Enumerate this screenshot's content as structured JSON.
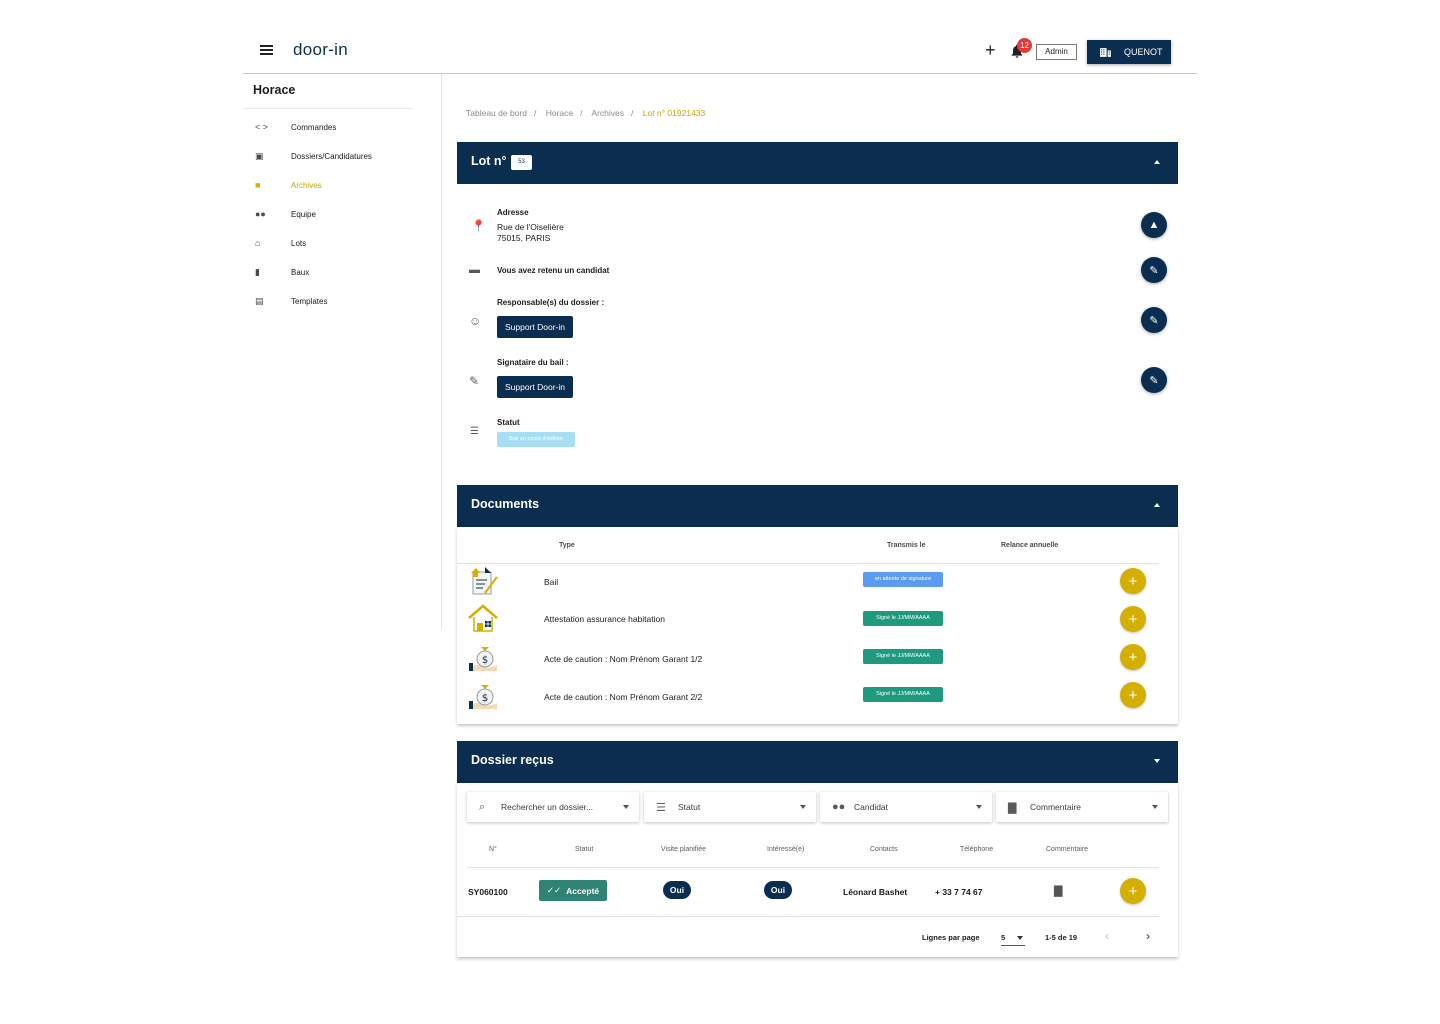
{
  "header": {
    "logo_text": "door-in",
    "notification_count": "12",
    "admin_label": "Admin",
    "company_label": "QUENOT"
  },
  "sidebar": {
    "title": "Horace",
    "items": [
      {
        "label": "Commandes",
        "icon": "code-icon"
      },
      {
        "label": "Dossiers/Candidatures",
        "icon": "id-card-icon"
      },
      {
        "label": "Archives",
        "icon": "archive-icon",
        "active": true
      },
      {
        "label": "Equipe",
        "icon": "people-icon"
      },
      {
        "label": "Lots",
        "icon": "home-icon"
      },
      {
        "label": "Baux",
        "icon": "book-icon"
      },
      {
        "label": "Templates",
        "icon": "document-icon"
      }
    ]
  },
  "breadcrumb": [
    "Tableau de bord",
    "Horace",
    "Archives",
    "Lot n° 01921433"
  ],
  "lot_panel": {
    "title": "Lot n°",
    "badge": "53",
    "address_label": "Adresse",
    "address_line1": "Rue de l'Oiselière",
    "address_line2": "75015, PARIS",
    "candidate_text": "Vous avez retenu un candidat",
    "responsible_label": "Responsable(s) du dossier :",
    "responsible_value": "Support Door-in",
    "signatory_label": "Signataire du bail :",
    "signatory_value": "Support Door-in",
    "status_label": "Statut",
    "status_value": "Bail en cours d'édition"
  },
  "documents_panel": {
    "title": "Documents",
    "headers": {
      "type": "Type",
      "sent": "Transmis le",
      "reminder": "Relance annuelle"
    },
    "rows": [
      {
        "name": "Bail",
        "tag": "en attente de signature",
        "tag_color": "#5b9bf0",
        "icon": "contract-icon"
      },
      {
        "name": "Attestation assurance habitation",
        "tag": "Signé le JJ/MM/AAAA",
        "tag_color": "#1f9a7f",
        "icon": "house-icon"
      },
      {
        "name": "Acte de caution : Nom Prénom Garant 1/2",
        "tag": "Signé le JJ/MM/AAAA",
        "tag_color": "#1f9a7f",
        "icon": "money-bag-icon"
      },
      {
        "name": "Acte de caution : Nom Prénom Garant 2/2",
        "tag": "Signé le JJ/MM/AAAA",
        "tag_color": "#1f9a7f",
        "icon": "money-bag-icon"
      }
    ]
  },
  "dossiers_panel": {
    "title": "Dossier reçus",
    "filters": {
      "search_placeholder": "Rechercher un dossier...",
      "status": "Statut",
      "candidate": "Candidat",
      "comment": "Commentaire"
    },
    "headers": [
      "N°",
      "Statut",
      "Visite planifiée",
      "Intéressé(e)",
      "Contacts",
      "Téléphone",
      "Commentaire"
    ],
    "row": {
      "number": "SY060100",
      "status": "Accepté",
      "visit": "Oui",
      "interested": "Oui",
      "contact": "Léonard Bashet",
      "phone": "+ 33 7 74 67"
    },
    "pagination": {
      "rows_label": "Lignes par page",
      "rows_value": "5",
      "range": "1-5 de 19"
    }
  },
  "colors": {
    "navy": "#0b2d4f",
    "gold": "#d4af00",
    "accepted": "#2f8374",
    "status_light": "#a7def3"
  }
}
